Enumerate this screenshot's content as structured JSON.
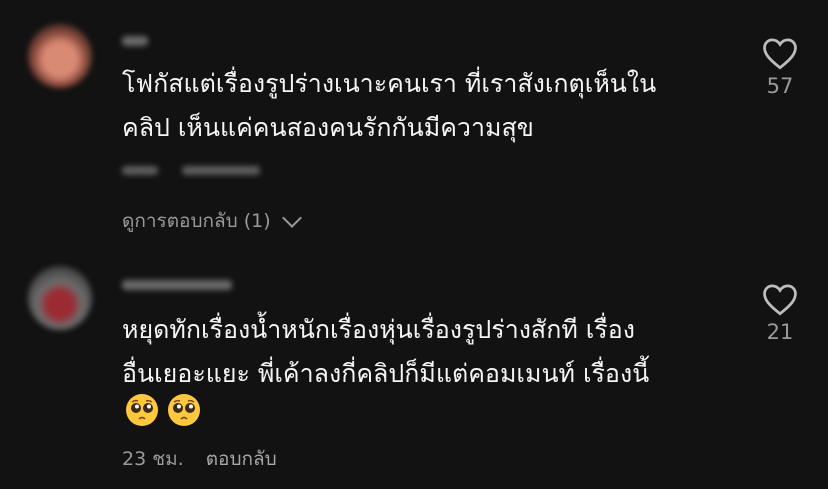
{
  "comments": [
    {
      "text": "โฟกัสแต่เรื่องรูปร่างเนาะคนเรา ที่เราสังเกตุเห็นใน\nคลิป เห็นแค่คนสองคนรักกันมีความสุข",
      "likes": "57",
      "view_replies": "ดูการตอบกลับ (1)"
    },
    {
      "text": "หยุดทักเรื่องน้ำหนักเรื่องหุ่นเรื่องรูปร่างสักที เรื่อง\nอื่นเยอะแยะ พี่เค้าลงกี่คลิปก็มีแต่คอมเมนท์ เรื่องนี้",
      "emojis": [
        "pleading-face-emoji",
        "pleading-face-emoji"
      ],
      "likes": "21",
      "time": "23 ชม.",
      "reply": "ตอบกลับ"
    }
  ],
  "colors": {
    "background": "#121212",
    "text": "#f5f5f5",
    "muted": "#9a9a9a"
  }
}
